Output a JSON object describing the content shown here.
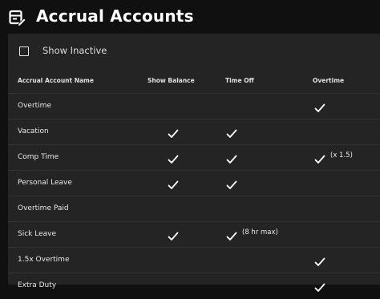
{
  "header": {
    "title": "Accrual Accounts",
    "icon": "accounts-edit-icon"
  },
  "filter": {
    "show_inactive_label": "Show Inactive",
    "show_inactive_checked": false
  },
  "table": {
    "columns": [
      "Accrual Account Name",
      "Show Balance",
      "Time Off",
      "Overtime"
    ],
    "rows": [
      {
        "name": "Overtime",
        "show_balance": false,
        "time_off": false,
        "time_off_note": "",
        "overtime": true,
        "overtime_note": ""
      },
      {
        "name": "Vacation",
        "show_balance": true,
        "time_off": true,
        "time_off_note": "",
        "overtime": false,
        "overtime_note": ""
      },
      {
        "name": "Comp Time",
        "show_balance": true,
        "time_off": true,
        "time_off_note": "",
        "overtime": true,
        "overtime_note": "(x 1.5)"
      },
      {
        "name": "Personal Leave",
        "show_balance": true,
        "time_off": true,
        "time_off_note": "",
        "overtime": false,
        "overtime_note": ""
      },
      {
        "name": "Overtime Paid",
        "show_balance": false,
        "time_off": false,
        "time_off_note": "",
        "overtime": false,
        "overtime_note": ""
      },
      {
        "name": "Sick Leave",
        "show_balance": true,
        "time_off": true,
        "time_off_note": "(8 hr max)",
        "overtime": false,
        "overtime_note": ""
      },
      {
        "name": "1.5x Overtime",
        "show_balance": false,
        "time_off": false,
        "time_off_note": "",
        "overtime": true,
        "overtime_note": ""
      },
      {
        "name": "Extra Duty",
        "show_balance": false,
        "time_off": false,
        "time_off_note": "",
        "overtime": true,
        "overtime_note": ""
      }
    ]
  }
}
